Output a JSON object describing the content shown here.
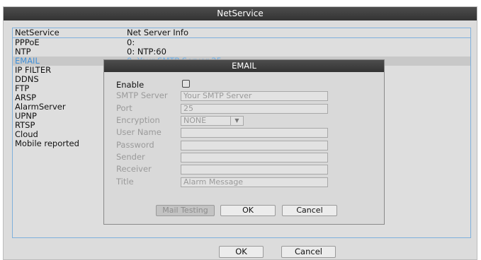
{
  "window": {
    "title": "NetService"
  },
  "list": {
    "headers": [
      "NetService",
      "Net Server Info"
    ],
    "rows": [
      {
        "name": "PPPoE",
        "info": "0:"
      },
      {
        "name": "NTP",
        "info": "0: NTP:60"
      },
      {
        "name": "EMAIL",
        "info": "0: Your SMTP Server:25"
      },
      {
        "name": "IP FILTER",
        "info": ""
      },
      {
        "name": "DDNS",
        "info": ""
      },
      {
        "name": "FTP",
        "info": ""
      },
      {
        "name": "ARSP",
        "info": ""
      },
      {
        "name": "AlarmServer",
        "info": ""
      },
      {
        "name": "UPNP",
        "info": ""
      },
      {
        "name": "RTSP",
        "info": ""
      },
      {
        "name": "Cloud",
        "info": ""
      },
      {
        "name": "Mobile reported",
        "info": ""
      }
    ]
  },
  "buttons": {
    "ok": "OK",
    "cancel": "Cancel"
  },
  "dialog": {
    "title": "EMAIL",
    "enable_label": "Enable",
    "enable_checked": false,
    "smtp_server_label": "SMTP Server",
    "smtp_server_value": "Your SMTP Server",
    "port_label": "Port",
    "port_value": "25",
    "encryption_label": "Encryption",
    "encryption_value": "NONE",
    "user_name_label": "User Name",
    "user_name_value": "",
    "password_label": "Password",
    "password_value": "",
    "sender_label": "Sender",
    "sender_value": "",
    "receiver_label": "Receiver",
    "receiver_value": "",
    "title_label": "Title",
    "title_value": "Alarm Message",
    "mail_testing": "Mail Testing",
    "ok": "OK",
    "cancel": "Cancel"
  },
  "colors": {
    "title_bar": "#3d3d3d",
    "panel_border": "#7fb0dc",
    "selected_text": "#3f8fd8"
  }
}
